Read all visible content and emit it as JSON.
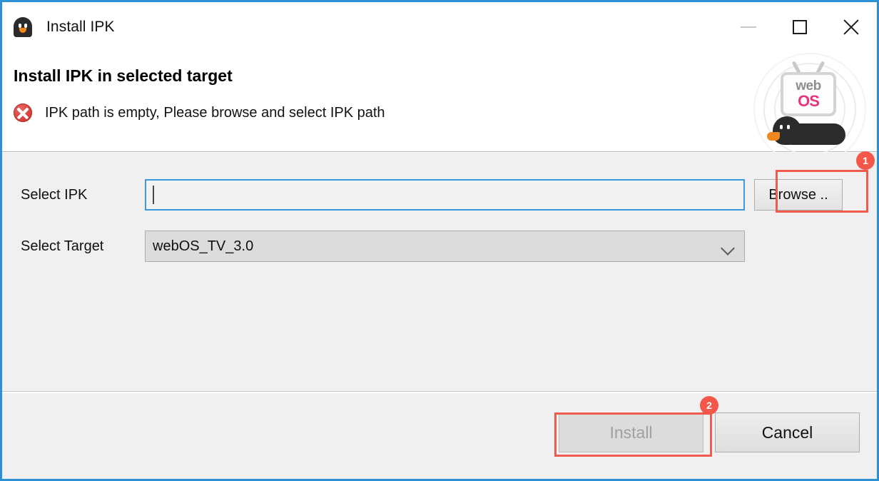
{
  "window": {
    "title": "Install IPK",
    "app_icon": "bean-bird-icon",
    "controls": {
      "minimize": "minimize-icon",
      "maximize": "maximize-icon",
      "close": "close-icon"
    }
  },
  "header": {
    "title": "Install IPK in selected target",
    "status_icon": "error-icon",
    "status_message": "IPK path is empty, Please browse and select IPK path",
    "logo": {
      "name": "webos-tv-logo",
      "text_top": "web",
      "text_bottom": "OS"
    }
  },
  "form": {
    "ipk": {
      "label": "Select IPK",
      "value": "",
      "placeholder": "",
      "browse_label": "Browse .."
    },
    "target": {
      "label": "Select Target",
      "selected": "webOS_TV_3.0",
      "options": [
        "webOS_TV_3.0"
      ]
    }
  },
  "footer": {
    "install_label": "Install",
    "cancel_label": "Cancel"
  },
  "annotations": [
    {
      "id": "1",
      "target": "browse-button"
    },
    {
      "id": "2",
      "target": "install-button"
    }
  ],
  "colors": {
    "accent_border": "#2d8fd5",
    "focus_border": "#3d9ae0",
    "error_red": "#d53f3a",
    "annotation_red": "#f15a4e",
    "logo_pink": "#e8337d"
  }
}
